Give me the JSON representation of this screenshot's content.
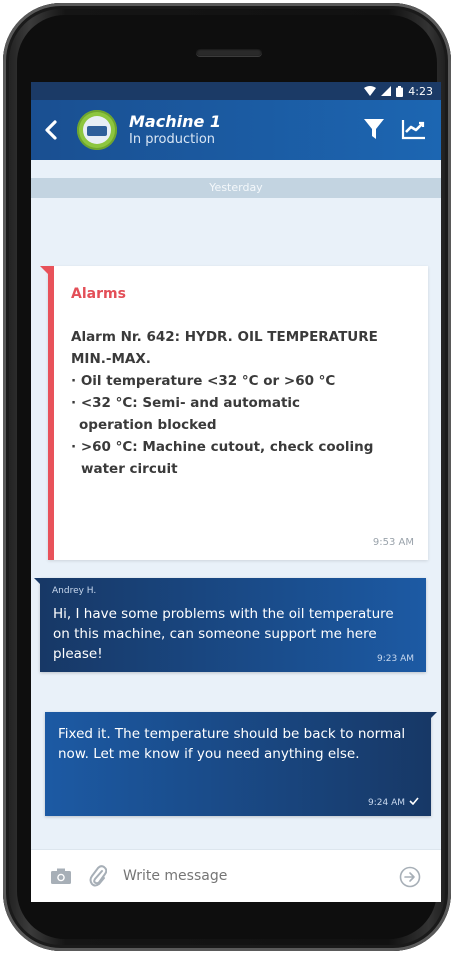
{
  "status_bar": {
    "time": "4:23"
  },
  "header": {
    "title": "Machine 1",
    "subtitle": "In production"
  },
  "chat": {
    "day_separator": "Yesterday",
    "alarm": {
      "title": "Alarms",
      "lines": [
        "Alarm Nr. 642: HYDR. OIL TEMPERATURE",
        "MIN.-MAX.",
        "· Oil temperature <32 °C or >60 °C",
        "· <32 °C: Semi- and automatic",
        "operation blocked",
        "· >60 °C: Machine cutout, check cooling",
        "water circuit"
      ],
      "time": "9:53 AM"
    },
    "incoming": {
      "sender": "Andrey H.",
      "text": "Hi, I have some problems with the oil temperature on this machine, can someone support me here please!",
      "time": "9:23 AM"
    },
    "outgoing": {
      "text": "Fixed it. The temperature should be back to normal now. Let me know if you need anything else.",
      "time": "9:24 AM"
    }
  },
  "composer": {
    "placeholder": "Write message"
  },
  "colors": {
    "app_bar": "#1c5aa4",
    "alarm_accent": "#e8525a",
    "bubble_dark": "#173866",
    "background": "#e9f1f9"
  },
  "icons": [
    "back-arrow-icon",
    "machine-avatar",
    "filter-icon",
    "trend-chart-icon",
    "camera-icon",
    "paperclip-icon",
    "send-icon",
    "check-icon",
    "wifi-icon",
    "signal-icon",
    "battery-icon"
  ]
}
